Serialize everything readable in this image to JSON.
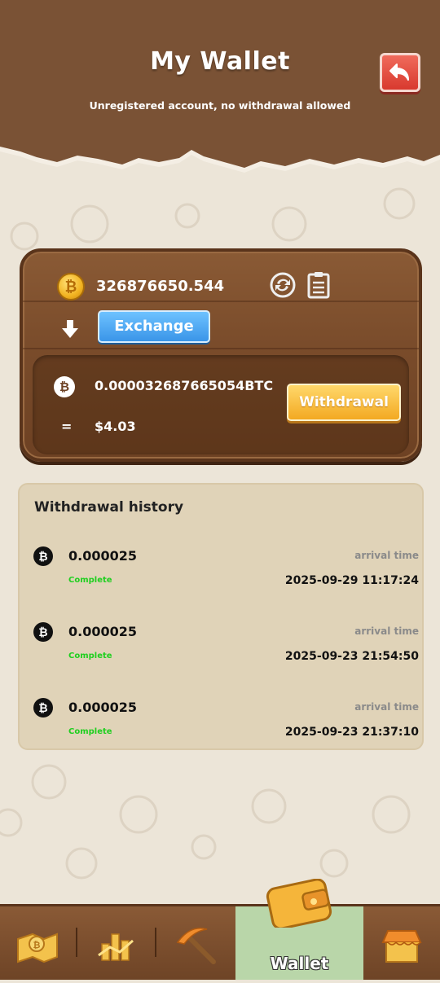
{
  "header": {
    "title": "My Wallet",
    "subtitle": "Unregistered account, no withdrawal allowed"
  },
  "wallet": {
    "coin_amount": "326876650.544",
    "exchange_label": "Exchange",
    "btc_amount": "0.000032687665054BTC",
    "equals": "=",
    "usd_amount": "$4.03",
    "withdraw_label": "Withdrawal"
  },
  "history": {
    "title": "Withdrawal history",
    "items": [
      {
        "amount": "0.000025",
        "status": "Complete",
        "label": "arrival time",
        "time": "2025-09-29 11:17:24"
      },
      {
        "amount": "0.000025",
        "status": "Complete",
        "label": "arrival time",
        "time": "2025-09-23 21:54:50"
      },
      {
        "amount": "0.000025",
        "status": "Complete",
        "label": "arrival time",
        "time": "2025-09-23 21:37:10"
      }
    ]
  },
  "nav": {
    "active_label": "Wallet",
    "icons": [
      "map-icon",
      "chart-icon",
      "pickaxe-icon",
      "wallet-icon",
      "shop-icon"
    ]
  },
  "colors": {
    "header_brown": "#7a5235",
    "status_green": "#1fcf1f",
    "exchange_blue": "#3a95e8",
    "withdraw_gold": "#f3a922"
  }
}
